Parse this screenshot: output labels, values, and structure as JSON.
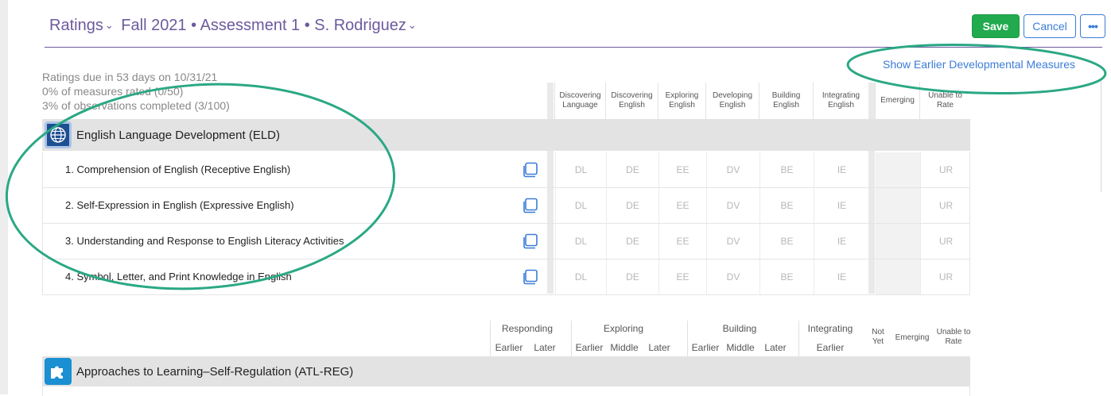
{
  "header": {
    "ratings_label": "Ratings",
    "period": "Fall 2021 • Assessment 1 • S. Rodriguez",
    "save": "Save",
    "cancel": "Cancel",
    "more": "•••",
    "show_earlier": "Show Earlier Developmental Measures"
  },
  "status": {
    "due": "Ratings due in 53 days on 10/31/21",
    "measures": "0% of measures rated (0/50)",
    "observations": "3% of observations completed (3/100)"
  },
  "eld": {
    "title": "English Language Development (ELD)",
    "columns": [
      "Discovering Language",
      "Discovering English",
      "Exploring English",
      "Developing English",
      "Building English",
      "Integrating English",
      "Emerging",
      "Unable to Rate"
    ],
    "codes": [
      "DL",
      "DE",
      "EE",
      "DV",
      "BE",
      "IE",
      "",
      "UR"
    ],
    "rows": [
      "1. Comprehension of English (Receptive English)",
      "2. Self-Expression in English (Expressive English)",
      "3. Understanding and Response to English Literacy Activities",
      "4. Symbol, Letter, and Print Knowledge in English"
    ]
  },
  "atl": {
    "title": "Approaches to Learning–Self-Regulation (ATL-REG)",
    "groups": [
      {
        "name": "Responding",
        "subs": [
          "Earlier",
          "Later"
        ]
      },
      {
        "name": "Exploring",
        "subs": [
          "Earlier",
          "Middle",
          "Later"
        ]
      },
      {
        "name": "Building",
        "subs": [
          "Earlier",
          "Middle",
          "Later"
        ]
      },
      {
        "name": "Integrating",
        "subs": [
          "Earlier"
        ]
      }
    ],
    "extra": [
      "Not Yet",
      "Emerging",
      "Unable to Rate"
    ]
  },
  "colors": {
    "title": "#6d5a9e",
    "save": "#22aa4e",
    "link": "#3b7dd8",
    "annotation": "#2aa884"
  },
  "icons": {
    "eld": "globe-icon",
    "atl": "puzzle-icon",
    "notes": "notes-icon"
  }
}
